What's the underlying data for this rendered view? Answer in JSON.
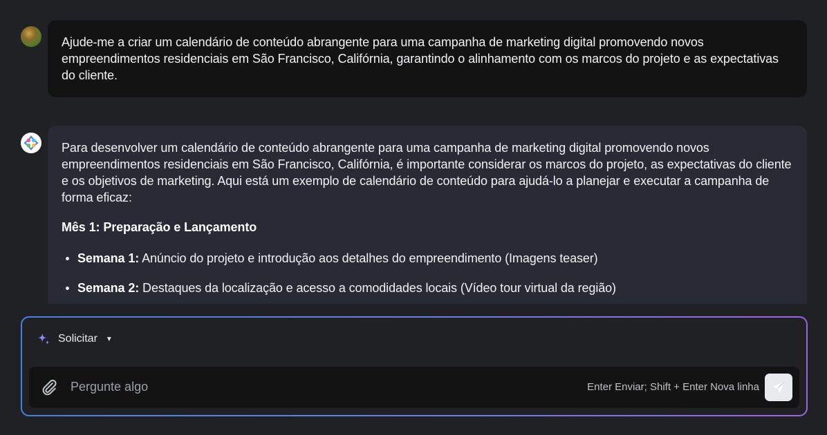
{
  "user_message": {
    "text": "Ajude-me a criar um calendário de conteúdo abrangente para uma campanha de marketing digital promovendo novos empreendimentos residenciais em São Francisco, Califórnia, garantindo o alinhamento com os marcos do projeto e as expectativas do cliente."
  },
  "ai_message": {
    "intro": "Para desenvolver um calendário de conteúdo abrangente para uma campanha de marketing digital promovendo novos empreendimentos residenciais em São Francisco, Califórnia, é importante considerar os marcos do projeto, as expectativas do cliente e os objetivos de marketing. Aqui está um exemplo de calendário de conteúdo para ajudá-lo a planejar e executar a campanha de forma eficaz:",
    "heading": "Mês 1: Preparação e Lançamento",
    "items": [
      {
        "label": "Semana 1:",
        "text": " Anúncio do projeto e introdução aos detalhes do empreendimento (Imagens teaser)"
      },
      {
        "label": "Semana 2:",
        "text": " Destaques da localização e acesso a comodidades locais (Vídeo tour virtual da região)"
      }
    ]
  },
  "composer": {
    "mode_label": "Solicitar",
    "placeholder": "Pergunte algo",
    "hint": "Enter Enviar; Shift + Enter Nova linha"
  },
  "icons": {
    "user_avatar": "user-avatar",
    "ai_avatar": "ai-logo-icon",
    "mode": "sparkle-icon",
    "caret": "caret-down-icon",
    "attach": "paperclip-icon",
    "send": "send-icon"
  },
  "colors": {
    "background": "#202124",
    "user_bubble": "#131314",
    "ai_bubble": "#282a36",
    "accent_start": "#4a7fe0",
    "accent_end": "#9a66e0"
  }
}
